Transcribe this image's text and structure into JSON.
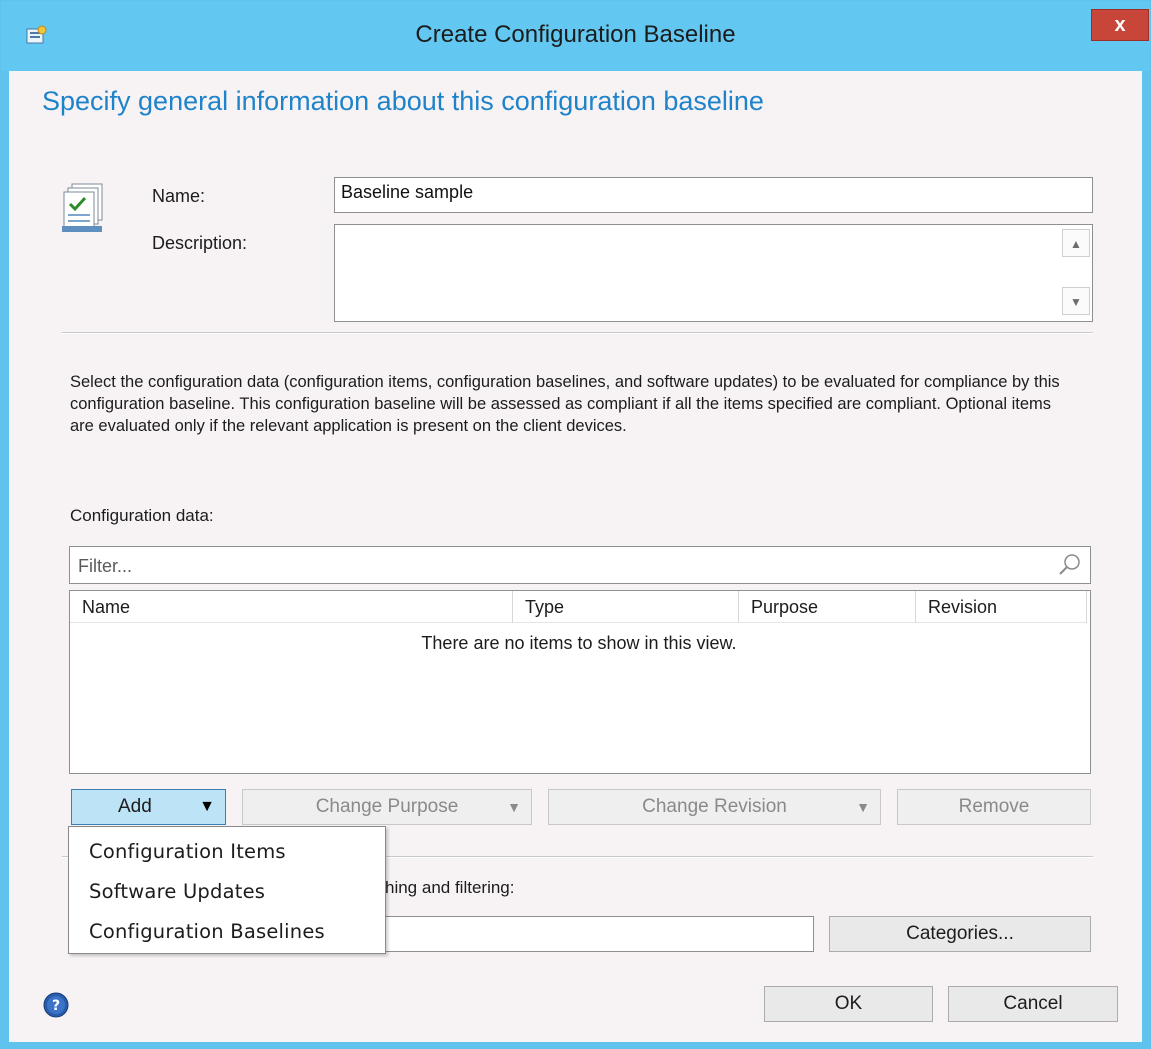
{
  "window": {
    "title": "Create Configuration Baseline",
    "close_label": "x"
  },
  "page": {
    "heading": "Specify general information about this configuration baseline"
  },
  "form": {
    "name_label": "Name:",
    "name_value": "Baseline sample",
    "description_label": "Description:",
    "description_value": ""
  },
  "instructions": "Select the configuration data (configuration items, configuration baselines, and software updates) to be evaluated for compliance by this configuration baseline. This configuration baseline will be assessed as compliant if all the items specified are compliant. Optional items are evaluated only if the relevant application is present on  the client devices.",
  "config_data": {
    "label": "Configuration data:",
    "filter_placeholder": "Filter...",
    "columns": [
      "Name",
      "Type",
      "Purpose",
      "Revision"
    ],
    "empty_message": "There are no items to show in this view."
  },
  "buttons": {
    "add": "Add",
    "change_purpose": "Change Purpose",
    "change_revision": "Change Revision",
    "remove": "Remove",
    "categories": "Categories...",
    "ok": "OK",
    "cancel": "Cancel"
  },
  "add_menu": {
    "items": [
      "Configuration Items",
      "Software Updates",
      "Configuration Baselines"
    ]
  },
  "categories_section": {
    "label_partial": "hing and filtering:"
  },
  "colors": {
    "titlebar": "#62c8f1",
    "heading": "#1f83c9",
    "close": "#c8453a",
    "add_button": "#bde3f7"
  }
}
